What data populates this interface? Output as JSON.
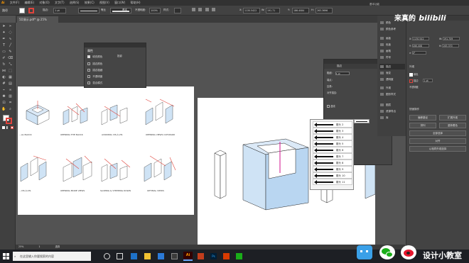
{
  "menubar": {
    "items": [
      "Ai",
      "文件(F)",
      "编辑(E)",
      "对象(O)",
      "文字(T)",
      "选择(S)",
      "效果(C)",
      "视图(V)",
      "窗口(W)",
      "帮助(H)"
    ],
    "right_label": "基本功能"
  },
  "controlbar": {
    "no_selection": "路径",
    "stroke_label": "描边:",
    "stroke_value": "1 pt",
    "uniform": "等比",
    "basic": "基本",
    "opacity_label": "不透明度:",
    "opacity_value": "100%",
    "style_label": "样式:",
    "x_value": "1130.5422",
    "w_value": "191.71",
    "y_value": "186.4084",
    "h_value": "263.3696"
  },
  "document_tab": {
    "title": "5D演示.pdf* @ 25% (RGB/GPU 预览)",
    "close": "×"
  },
  "transparency_panel": {
    "title": "属性",
    "rows": [
      {
        "label": "填充颜色",
        "value": "投影"
      },
      {
        "label": "描边颜色",
        "value": ""
      },
      {
        "label": "描边粗细",
        "value": ""
      },
      {
        "label": "不透明度",
        "value": ""
      },
      {
        "label": "混合模式",
        "value": ""
      }
    ]
  },
  "stroke_panel": {
    "tab_title": "描边",
    "weight_label": "粗细:",
    "weight_value": "1 pt",
    "cap_label": "端点:",
    "corner_label": "边角:",
    "limit_label": "限制:",
    "align_label": "对齐描边:",
    "dashed_label": "虚线",
    "arrow_label": "箭头:",
    "scale_label": "缩放:",
    "align2_label": "对齐:",
    "profile_label": "配置文件:"
  },
  "arrow_list": [
    "箭头 2",
    "箭头 3",
    "箭头 4",
    "箭头 5",
    "箭头 6",
    "箭头 7",
    "箭头 8",
    "箭头 9",
    "箭头 10",
    "箭头 11"
  ],
  "dock": {
    "items": [
      "颜色",
      "颜色参考",
      "画板",
      "色板",
      "画笔",
      "符号",
      "描边",
      "渐变",
      "透明度",
      "外观",
      "图形样式",
      "图层",
      "资源导出",
      "库"
    ]
  },
  "properties": {
    "title": "属性",
    "x_value": "1130.542",
    "w_value": "191.709",
    "y_value": "186.408",
    "h_value": "263.370",
    "angle_value": "0°",
    "appearance_title": "外观",
    "fill_label": "填色",
    "stroke_label": "描边",
    "stroke_value": "1 pt",
    "opacity_label": "不透明度",
    "quick_actions": "快速操作",
    "buttons": [
      "偏移路径",
      "扩展外观",
      "排列",
      "重新着色",
      "全部选择",
      "对齐",
      "以相同外观选择"
    ]
  },
  "diagrams": {
    "row1": [
      "...AL BLOCK",
      "OPENING THE BLOCK",
      "AVOIDING VIS-À-VIS",
      "OPENING VIEWS OUTWARD"
    ],
    "row2": [
      "...VIS-À-VIS",
      "OPENING MORE VIEWS",
      "SLOPING & STEPPING DOWN",
      "OPTIMAL VIEWS"
    ]
  },
  "statusbar": {
    "zoom": "25%",
    "page": "1",
    "tool": "选择"
  },
  "taskbar": {
    "search_placeholder": "在这里输入你要搜索的内容"
  },
  "watermark": {
    "top_text": "来真的",
    "top_brand": "bilibili",
    "bottom_text": "设计小教室"
  },
  "colors": {
    "app_bg": "#535353",
    "panel": "#454545",
    "accent_blue": "#2f7fd8",
    "artwork_blue": "#cfe3f5",
    "arrow_red": "#e0443c",
    "taskbar": "#1d1f24"
  }
}
